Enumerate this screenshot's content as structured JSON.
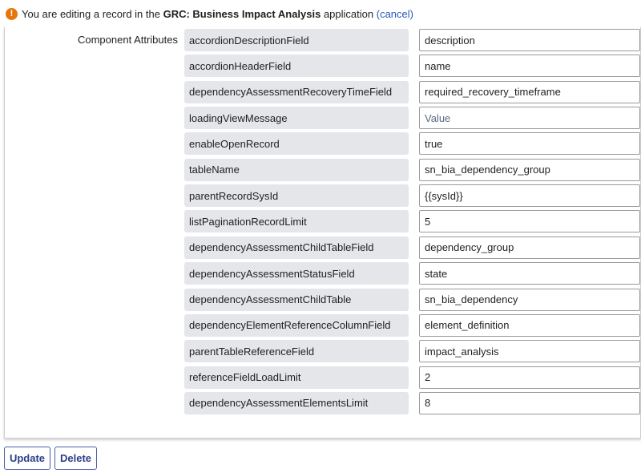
{
  "banner": {
    "icon": "exclamation-icon",
    "icon_glyph": "!",
    "prefix": "You are editing a record in the ",
    "app_name": "GRC: Business Impact Analysis",
    "suffix": " application ",
    "cancel_label": "(cancel)",
    "icon_color": "#e8740c"
  },
  "section": {
    "label": "Component Attributes"
  },
  "attributes": [
    {
      "name": "accordionDescriptionField",
      "value": "description",
      "placeholder": ""
    },
    {
      "name": "accordionHeaderField",
      "value": "name",
      "placeholder": ""
    },
    {
      "name": "dependencyAssessmentRecoveryTimeField",
      "value": "required_recovery_timeframe",
      "placeholder": ""
    },
    {
      "name": "loadingViewMessage",
      "value": "",
      "placeholder": "Value"
    },
    {
      "name": "enableOpenRecord",
      "value": "true",
      "placeholder": ""
    },
    {
      "name": "tableName",
      "value": "sn_bia_dependency_group",
      "placeholder": ""
    },
    {
      "name": "parentRecordSysId",
      "value": "{{sysId}}",
      "placeholder": ""
    },
    {
      "name": "listPaginationRecordLimit",
      "value": "5",
      "placeholder": ""
    },
    {
      "name": "dependencyAssessmentChildTableField",
      "value": "dependency_group",
      "placeholder": ""
    },
    {
      "name": "dependencyAssessmentStatusField",
      "value": "state",
      "placeholder": ""
    },
    {
      "name": "dependencyAssessmentChildTable",
      "value": "sn_bia_dependency",
      "placeholder": ""
    },
    {
      "name": "dependencyElementReferenceColumnField",
      "value": "element_definition",
      "placeholder": ""
    },
    {
      "name": "parentTableReferenceField",
      "value": "impact_analysis",
      "placeholder": ""
    },
    {
      "name": "referenceFieldLoadLimit",
      "value": "2",
      "placeholder": ""
    },
    {
      "name": "dependencyAssessmentElementsLimit",
      "value": "8",
      "placeholder": ""
    }
  ],
  "actions": {
    "update_label": "Update",
    "delete_label": "Delete"
  }
}
